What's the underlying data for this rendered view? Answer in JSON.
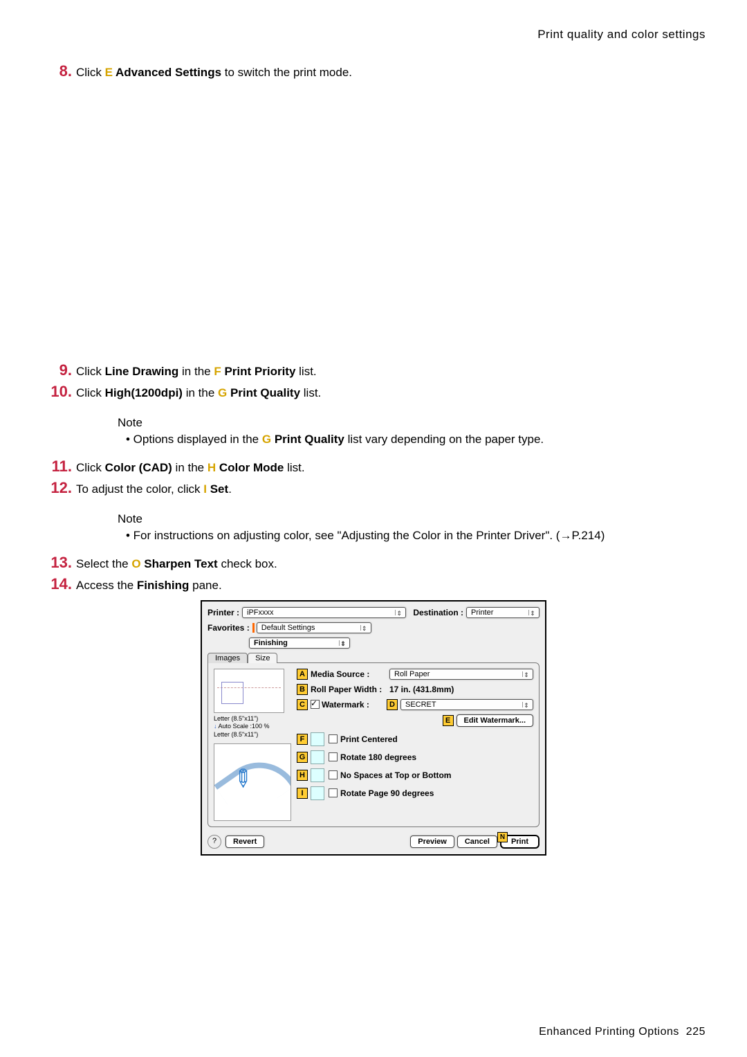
{
  "header": "Print quality and color settings",
  "steps": {
    "s8": {
      "num": "8.",
      "pre": "Click ",
      "key": "E",
      "bold": " Advanced Settings",
      "post": " to switch the print mode."
    },
    "s9": {
      "num": "9.",
      "pre": "Click ",
      "bold1": "Line Drawing",
      "mid": " in the ",
      "key": "F",
      "bold2": " Print Priority",
      "post": " list."
    },
    "s10": {
      "num": "10.",
      "pre": "Click ",
      "bold1": "High(1200dpi)",
      "mid": " in the ",
      "key": "G",
      "bold2": " Print Quality",
      "post": " list."
    },
    "s11": {
      "num": "11.",
      "pre": "Click ",
      "bold1": "Color (CAD)",
      "mid": " in the ",
      "key": "H",
      "bold2": " Color Mode",
      "post": " list."
    },
    "s12": {
      "num": "12.",
      "pre": "To adjust the color, click ",
      "key": "I",
      "bold": " Set",
      "post": "."
    },
    "s13": {
      "num": "13.",
      "pre": "Select the ",
      "key": "O",
      "bold": " Sharpen Text",
      "post": " check box."
    },
    "s14": {
      "num": "14.",
      "pre": "Access the ",
      "bold": "Finishing",
      "post": " pane."
    }
  },
  "notes": {
    "label": "Note",
    "n1": {
      "pre": "• Options displayed in the ",
      "key": "G",
      "bold": " Print Quality",
      "post": " list vary depending on the paper type."
    },
    "n2": "• For instructions on adjusting color, see \"Adjusting the Color in the Printer Driver\". (→P.214)"
  },
  "dialog": {
    "printerLabel": "Printer :",
    "printerVal": "iPFxxxx",
    "destLabel": "Destination :",
    "destVal": "Printer",
    "favLabel": "Favorites :",
    "favVal": "Default Settings",
    "paneSelect": "Finishing",
    "tabs": {
      "images": "Images",
      "size": "Size"
    },
    "rows": {
      "A": {
        "label": "Media Source :",
        "val": "Roll Paper"
      },
      "B": {
        "label": "Roll Paper Width :",
        "val": "17 in. (431.8mm)"
      },
      "C": {
        "label": "Watermark :"
      },
      "D": {
        "val": "SECRET"
      },
      "E": {
        "btn": "Edit Watermark..."
      },
      "F": {
        "label": "Print Centered"
      },
      "G": {
        "label": "Rotate 180 degrees"
      },
      "H": {
        "label": "No Spaces at Top or Bottom"
      },
      "I": {
        "label": "Rotate Page 90 degrees"
      }
    },
    "thumb": {
      "line1": "Letter (8.5\"x11\")",
      "line2": "Auto Scale :100 %",
      "line3": "Letter (8.5\"x11\")"
    },
    "buttons": {
      "help": "?",
      "revert": "Revert",
      "preview": "Preview",
      "cancel": "Cancel",
      "print": "Print",
      "nKey": "N"
    }
  },
  "footer": {
    "text": "Enhanced Printing Options",
    "page": "225"
  }
}
